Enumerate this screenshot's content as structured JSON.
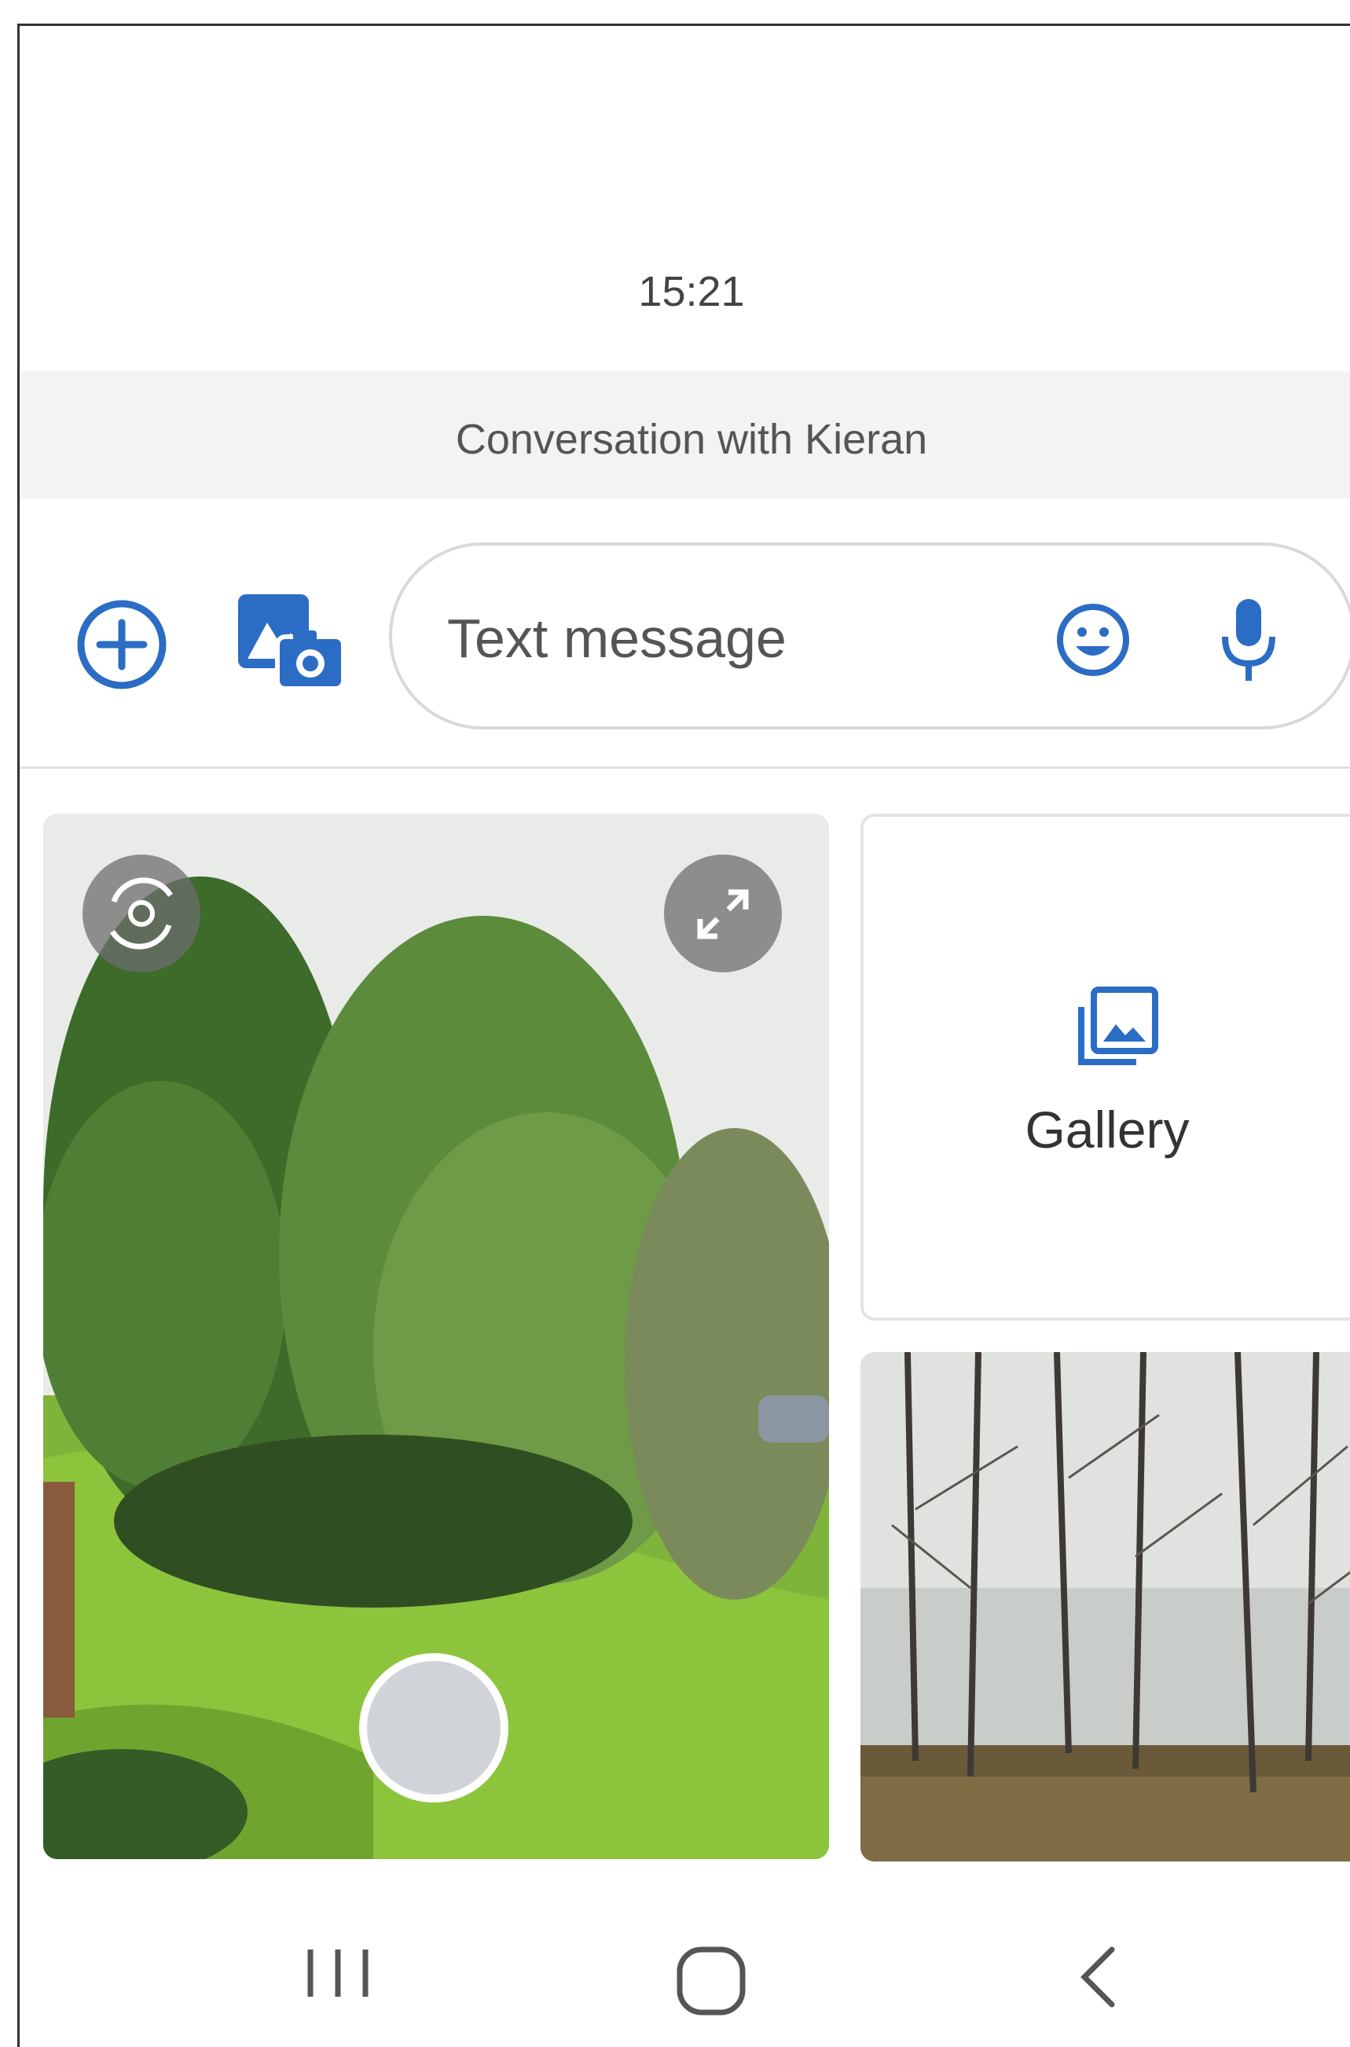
{
  "status": {
    "time": "15:21"
  },
  "conversation": {
    "title": "Conversation with Kieran"
  },
  "compose": {
    "placeholder": "Text message",
    "icons": [
      "add-circle-icon",
      "gallery-camera-icon",
      "emoji-icon",
      "microphone-icon"
    ]
  },
  "media_picker": {
    "camera": {
      "icons": [
        "switch-camera-icon",
        "expand-icon"
      ],
      "shutter": "shutter-button"
    },
    "gallery_label": "Gallery",
    "gallery_icon": "photo-library-icon",
    "recent_photo": "foggy-forest-photo"
  },
  "nav": {
    "icons": [
      "recent-apps-icon",
      "home-icon",
      "back-icon"
    ]
  },
  "colors": {
    "accent": "#2b6cc4",
    "bar": "#f3f3f3",
    "shutter": "#d0d4d9"
  }
}
